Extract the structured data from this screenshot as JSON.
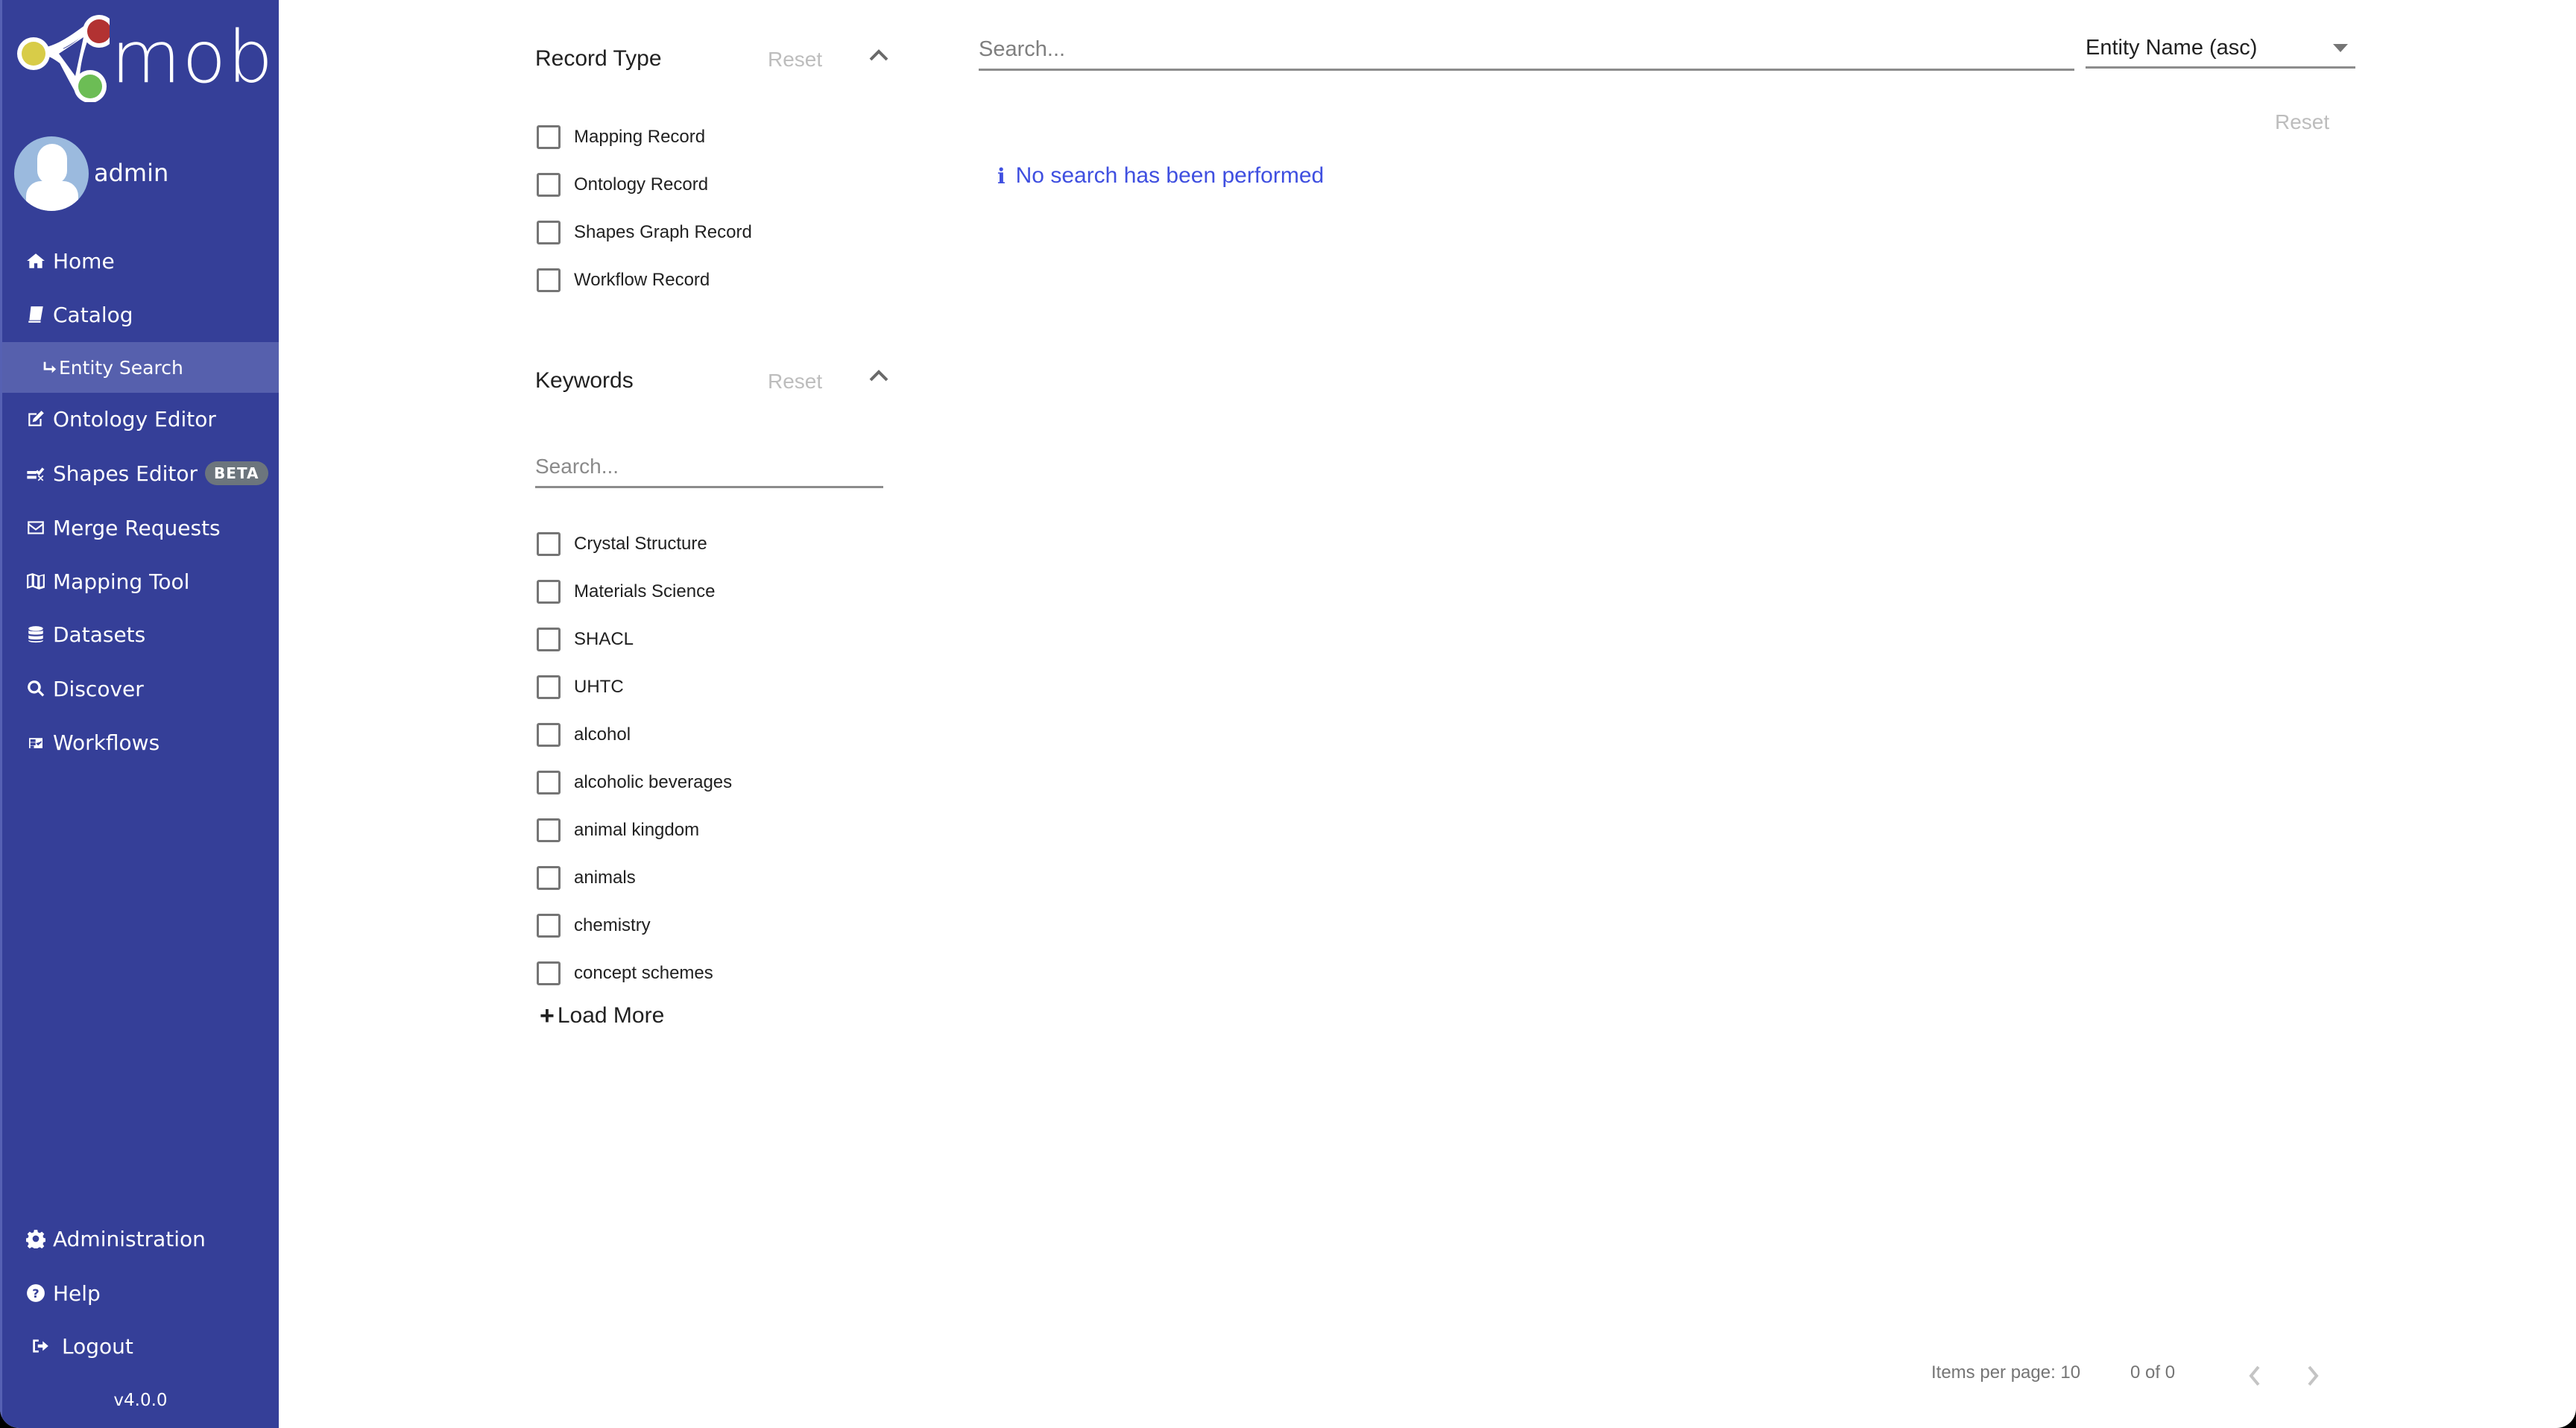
{
  "app": {
    "name": "mobi",
    "brand_color": "#353f98",
    "active_color": "#5660ad",
    "logo_colors": {
      "red": "#b23232",
      "yellow": "#d8cc48",
      "green": "#6cbd55"
    }
  },
  "user": {
    "name": "admin"
  },
  "sidebar": {
    "items": [
      {
        "label": "Home",
        "icon": "home-icon"
      },
      {
        "label": "Catalog",
        "icon": "book-icon"
      },
      {
        "label": "Entity Search",
        "icon": "arrow-return-icon",
        "active": true,
        "sub": true
      },
      {
        "label": "Ontology Editor",
        "icon": "edit-icon"
      },
      {
        "label": "Shapes Editor",
        "icon": "shapes-check-icon",
        "badge": "BETA"
      },
      {
        "label": "Merge Requests",
        "icon": "envelope-icon"
      },
      {
        "label": "Mapping Tool",
        "icon": "map-icon"
      },
      {
        "label": "Datasets",
        "icon": "database-icon"
      },
      {
        "label": "Discover",
        "icon": "search-icon"
      },
      {
        "label": "Workflows",
        "icon": "workflow-icon"
      }
    ],
    "bottom_items": [
      {
        "label": "Administration",
        "icon": "gear-icon"
      },
      {
        "label": "Help",
        "icon": "help-icon"
      },
      {
        "label": "Logout",
        "icon": "logout-icon"
      }
    ],
    "version": "v4.0.0"
  },
  "filters": {
    "record_type": {
      "title": "Record Type",
      "reset_label": "Reset",
      "options": [
        "Mapping Record",
        "Ontology Record",
        "Shapes Graph Record",
        "Workflow Record"
      ]
    },
    "keywords": {
      "title": "Keywords",
      "reset_label": "Reset",
      "search_placeholder": "Search...",
      "options": [
        "Crystal Structure",
        "Materials Science",
        "SHACL",
        "UHTC",
        "alcohol",
        "alcoholic beverages",
        "animal kingdom",
        "animals",
        "chemistry",
        "concept schemes"
      ],
      "load_more_label": "Load More"
    }
  },
  "main": {
    "search_placeholder": "Search...",
    "sort_value": "Entity Name (asc)",
    "reset_label": "Reset",
    "info_message": "No search has been performed",
    "info_color": "#3f4fe0"
  },
  "pagination": {
    "items_per_page": "Items per page: 10",
    "range": "0 of 0"
  }
}
